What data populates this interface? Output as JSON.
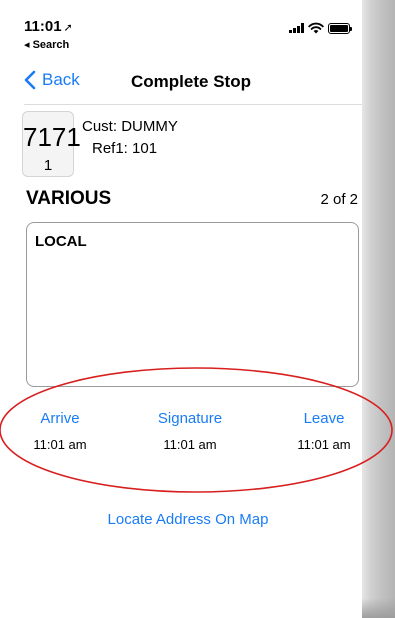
{
  "status_bar": {
    "time": "11:01",
    "location_arrow": "➚",
    "back_app": "◂ Search"
  },
  "nav": {
    "back_label": "Back",
    "title": "Complete Stop"
  },
  "stop": {
    "number": "7171",
    "sequence": "1",
    "customer_label": "Cust:",
    "customer_value": "DUMMY",
    "ref_label": "Ref1:",
    "ref_value": "101"
  },
  "section": {
    "title": "VARIOUS",
    "page_count": "2 of 2"
  },
  "notes": {
    "text": "LOCAL"
  },
  "times": {
    "arrive_label": "Arrive",
    "arrive_time": "11:01 am",
    "signature_label": "Signature",
    "signature_time": "11:01 am",
    "leave_label": "Leave",
    "leave_time": "11:01 am"
  },
  "actions": {
    "locate_label": "Locate Address On Map"
  },
  "colors": {
    "accent": "#1a7cf5",
    "annotation": "#d81f1f"
  }
}
